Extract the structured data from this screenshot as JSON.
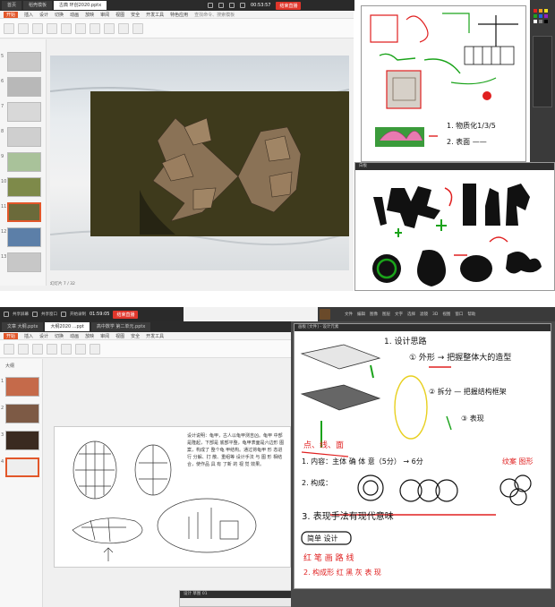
{
  "top": {
    "wps": {
      "tabs": [
        "首页",
        "稻壳模板",
        "古典 环创2020.pptx"
      ],
      "ribbon_tabs": [
        "开始",
        "插入",
        "设计",
        "切换",
        "动画",
        "放映",
        "审阅",
        "视图",
        "安全",
        "开发工具",
        "特色应用"
      ],
      "search": "查找命令、搜索模板",
      "slide_numbers": [
        "5",
        "6",
        "7",
        "8",
        "9",
        "10",
        "11",
        "12",
        "13"
      ],
      "status": "幻灯片 7 / 32"
    },
    "meeting": {
      "timer": "00:53:57",
      "live_label": "结束直播"
    },
    "whiteboard": {
      "notes": [
        "1. 物质化1/3/5",
        "2. 表面 ——"
      ],
      "window_title": "白板"
    }
  },
  "bottom": {
    "meeting": {
      "timer": "01:59:05",
      "live_label": "结束直播",
      "labels": [
        "共享屏幕",
        "共享窗口",
        "开始录制",
        "管理成员",
        "邀请成员",
        "应用"
      ]
    },
    "wps": {
      "tabs": [
        "文章 大纲.pptx",
        "大纲2020 ...ppt",
        "高中数学 第二单元.pptx"
      ],
      "ribbon_tabs": [
        "开始",
        "插入",
        "设计",
        "切换",
        "动画",
        "放映",
        "审阅",
        "视图",
        "安全",
        "开发工具"
      ],
      "outline_label": "大纲",
      "slide_numbers": [
        "1",
        "2",
        "3",
        "4"
      ],
      "slide_text": "设计说明：龟甲，古人以龟甲测吉凶。龟甲 中部是隆起，下部是 底部平整，龟甲表面是六边形 图 案，构成了 整个龟 甲结构。通过将龟甲 形 态进行 分解、打 散、重组等 设计手法 与 图 形 相结合，使作品 具 有 了新 的 视 觉 效果。"
    },
    "whiteboard": {
      "window_title": "画板 [文件] - 设计元素",
      "heading": "1. 设计思路",
      "lines": [
        "① 外形 → 把握整体大的造型",
        "② 拆分 — 把握结构框架",
        "③ 表现",
        "点、线、面",
        "1. 内容：主体 确 体 意（5分） → 6分",
        "2. 构成：",
        "3. 表现手法有现代意味",
        "简单 设计"
      ],
      "red_labels": [
        "纹案 图形",
        "红  笔  画  路 线",
        "2. 构成形  红  黑  灰  表 现"
      ]
    },
    "small_window": "设计 草图 01",
    "ps_menu": [
      "文件",
      "编辑",
      "图像",
      "图层",
      "文字",
      "选择",
      "滤镜",
      "3D",
      "视图",
      "窗口",
      "帮助"
    ],
    "colors": {
      "wps_accent": "#e2572a",
      "live_red": "#e0362b",
      "marker_green": "#1aa31a",
      "marker_red": "#e02020",
      "marker_black": "#111111",
      "ps_bg": "#3a3a3a"
    }
  }
}
